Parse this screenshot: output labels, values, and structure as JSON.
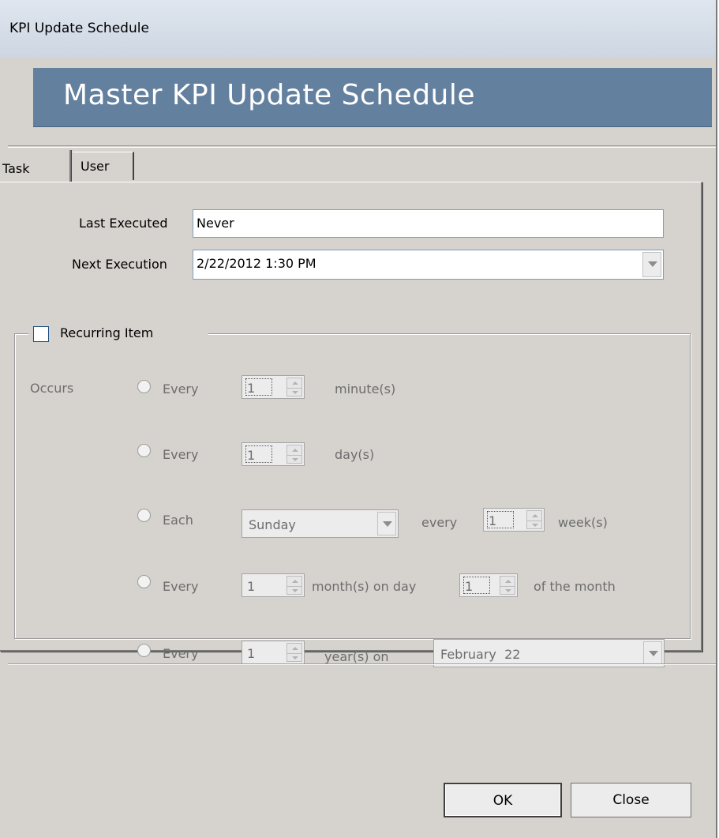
{
  "window": {
    "title": "KPI Update Schedule"
  },
  "banner": {
    "title": "Master KPI Update Schedule"
  },
  "tabs": [
    {
      "label": "Task",
      "active": true
    },
    {
      "label": "User",
      "active": false
    }
  ],
  "task": {
    "last_executed_label": "Last Executed",
    "last_executed_value": "Never",
    "next_execution_label": "Next Execution",
    "next_execution_value": "2/22/2012 1:30 PM"
  },
  "recurring": {
    "label": "Recurring Item",
    "checked": false,
    "occurs_label": "Occurs",
    "options": [
      {
        "prefix": "Every",
        "value": "1",
        "suffix": "minute(s)"
      },
      {
        "prefix": "Every",
        "value": "1",
        "suffix": "day(s)"
      },
      {
        "prefix": "Each",
        "day": "Sunday",
        "middle": "every",
        "value": "1",
        "suffix": "week(s)"
      },
      {
        "prefix": "Every",
        "value": "1",
        "middle": "month(s) on day",
        "value2": "1",
        "suffix": "of the month"
      },
      {
        "prefix": "Every",
        "value": "1",
        "middle": "year(s) on",
        "date": "February  22"
      }
    ]
  },
  "buttons": {
    "ok": "OK",
    "close": "Close"
  },
  "colors": {
    "banner": "#63809f",
    "window_bg": "#d6d3ce",
    "titlebar": "#d1d8e3"
  }
}
